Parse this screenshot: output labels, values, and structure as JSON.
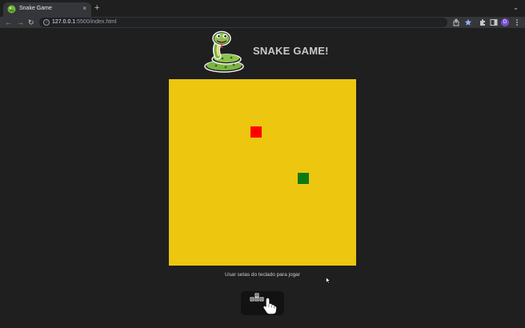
{
  "browser": {
    "tab_title": "Snake Game",
    "close_glyph": "×",
    "new_tab_glyph": "+",
    "tab_menu_glyph": "⌄",
    "back_glyph": "←",
    "forward_glyph": "→",
    "reload_glyph": "↻",
    "url_host": "127.0.0.1",
    "url_rest": ":5500/index.html",
    "avatar_initial": "D"
  },
  "page": {
    "title": "SNAKE GAME!",
    "instructions": "Usar setas do teclado para jogar"
  },
  "colors": {
    "board": "#edc60f",
    "food": "#ff0000",
    "snake": "#0a7a10",
    "background": "#1f1f1f"
  },
  "icons": [
    "snake-logo-icon",
    "arrow-keys-hand-icon",
    "share-icon",
    "star-icon",
    "extensions-icon",
    "sidebar-icon",
    "menu-icon"
  ]
}
